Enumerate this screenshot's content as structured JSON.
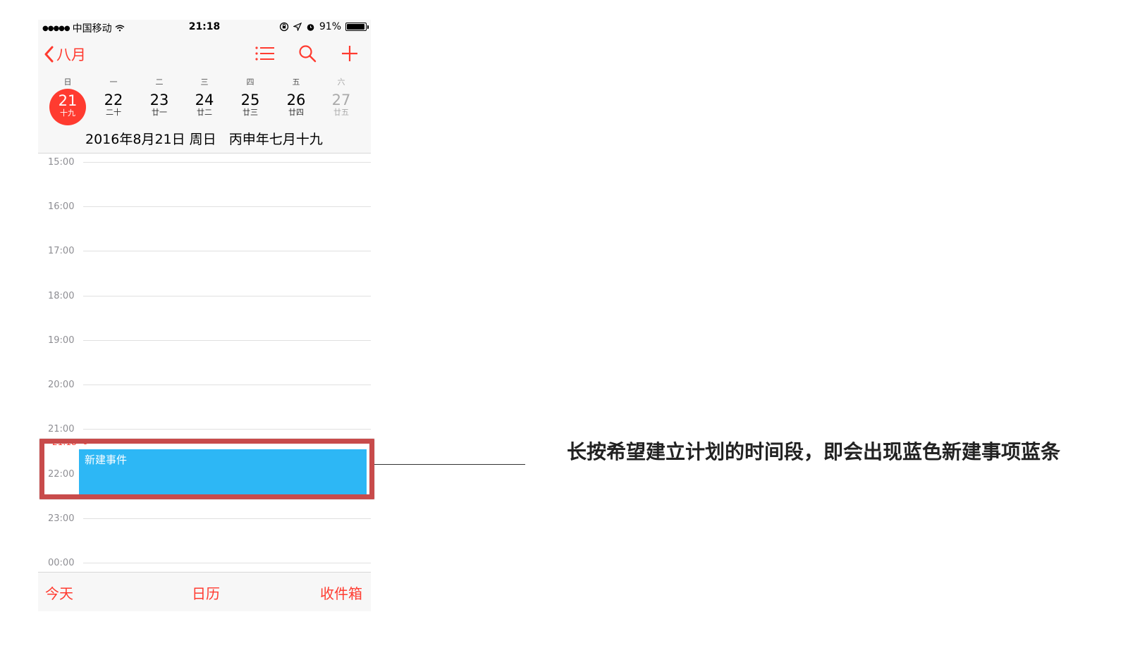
{
  "status_bar": {
    "signal": "●●●●●",
    "carrier": "中国移动",
    "time": "21:18",
    "battery_pct": "91%",
    "battery_level": 0.91
  },
  "nav": {
    "back_label": "八月",
    "icons": [
      "list-icon",
      "search-icon",
      "add-icon"
    ]
  },
  "week": {
    "weekdays": [
      "日",
      "一",
      "二",
      "三",
      "四",
      "五",
      "六"
    ],
    "days": [
      {
        "num": "21",
        "lunar": "十九",
        "selected": true
      },
      {
        "num": "22",
        "lunar": "二十"
      },
      {
        "num": "23",
        "lunar": "廿一"
      },
      {
        "num": "24",
        "lunar": "廿二"
      },
      {
        "num": "25",
        "lunar": "廿三"
      },
      {
        "num": "26",
        "lunar": "廿四"
      },
      {
        "num": "27",
        "lunar": "廿五",
        "dim": true
      }
    ]
  },
  "date_line": "2016年8月21日 周日   丙申年七月十九",
  "timeline": {
    "hours": [
      "15:00",
      "16:00",
      "17:00",
      "18:00",
      "19:00",
      "20:00",
      "21:00",
      "22:00",
      "23:00",
      "00:00"
    ],
    "now_label": "21:18"
  },
  "event": {
    "title": "新建事件",
    "color": "#2db7f5"
  },
  "tabbar": {
    "today": "今天",
    "calendars": "日历",
    "inbox": "收件箱"
  },
  "annotation": "长按希望建立计划的时间段，即会出现蓝色新建事项蓝条",
  "colors": {
    "accent": "#ff3b30",
    "highlight_border": "#c84b4b"
  }
}
